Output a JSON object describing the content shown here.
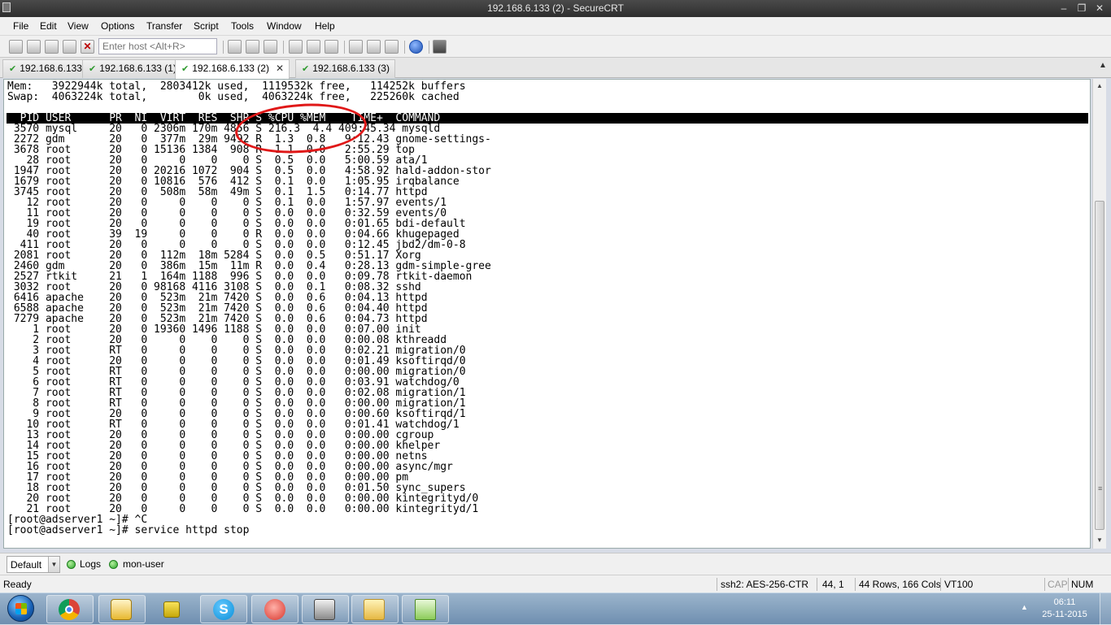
{
  "window": {
    "title": "192.168.6.133 (2) - SecureCRT"
  },
  "menu": [
    "File",
    "Edit",
    "View",
    "Options",
    "Transfer",
    "Script",
    "Tools",
    "Window",
    "Help"
  ],
  "toolbar": {
    "host_placeholder": "Enter host <Alt+R>"
  },
  "tabs": [
    {
      "label": "192.168.6.133",
      "active": false
    },
    {
      "label": "192.168.6.133 (1)",
      "active": false
    },
    {
      "label": "192.168.6.133 (2)",
      "active": true
    },
    {
      "label": "192.168.6.133 (3)",
      "active": false
    }
  ],
  "terminal": {
    "lines": [
      "Mem:   3922944k total,  2803412k used,  1119532k free,   114252k buffers",
      "Swap:  4063224k total,        0k used,  4063224k free,   225260k cached",
      "",
      "  PID USER      PR  NI  VIRT  RES  SHR S %CPU %MEM    TIME+  COMMAND",
      " 3570 mysql     20   0 2306m 170m 4856 S 216.3  4.4 409:45.34 mysqld",
      " 2272 gdm       20   0  377m  29m 9492 R  1.3  0.8   9:12.43 gnome-settings-",
      " 3678 root      20   0 15136 1384  908 R  1.1  0.0   2:55.29 top",
      "   28 root      20   0     0    0    0 S  0.5  0.0   5:00.59 ata/1",
      " 1947 root      20   0 20216 1072  904 S  0.5  0.0   4:58.92 hald-addon-stor",
      " 1679 root      20   0 10816  576  412 S  0.1  0.0   1:05.95 irqbalance",
      " 3745 root      20   0  508m  58m  49m S  0.1  1.5   0:14.77 httpd",
      "   12 root      20   0     0    0    0 S  0.1  0.0   1:57.97 events/1",
      "   11 root      20   0     0    0    0 S  0.0  0.0   0:32.59 events/0",
      "   19 root      20   0     0    0    0 S  0.0  0.0   0:01.65 bdi-default",
      "   40 root      39  19     0    0    0 R  0.0  0.0   0:04.66 khugepaged",
      "  411 root      20   0     0    0    0 S  0.0  0.0   0:12.45 jbd2/dm-0-8",
      " 2081 root      20   0  112m  18m 5284 S  0.0  0.5   0:51.17 Xorg",
      " 2460 gdm       20   0  386m  15m  11m R  0.0  0.4   0:28.13 gdm-simple-gree",
      " 2527 rtkit     21   1  164m 1188  996 S  0.0  0.0   0:09.78 rtkit-daemon",
      " 3032 root      20   0 98168 4116 3108 S  0.0  0.1   0:08.32 sshd",
      " 6416 apache    20   0  523m  21m 7420 S  0.0  0.6   0:04.13 httpd",
      " 6588 apache    20   0  523m  21m 7420 S  0.0  0.6   0:04.40 httpd",
      " 7279 apache    20   0  523m  21m 7420 S  0.0  0.6   0:04.73 httpd",
      "    1 root      20   0 19360 1496 1188 S  0.0  0.0   0:07.00 init",
      "    2 root      20   0     0    0    0 S  0.0  0.0   0:00.08 kthreadd",
      "    3 root      RT   0     0    0    0 S  0.0  0.0   0:02.21 migration/0",
      "    4 root      20   0     0    0    0 S  0.0  0.0   0:01.49 ksoftirqd/0",
      "    5 root      RT   0     0    0    0 S  0.0  0.0   0:00.00 migration/0",
      "    6 root      RT   0     0    0    0 S  0.0  0.0   0:03.91 watchdog/0",
      "    7 root      RT   0     0    0    0 S  0.0  0.0   0:02.08 migration/1",
      "    8 root      RT   0     0    0    0 S  0.0  0.0   0:00.00 migration/1",
      "    9 root      20   0     0    0    0 S  0.0  0.0   0:00.60 ksoftirqd/1",
      "   10 root      RT   0     0    0    0 S  0.0  0.0   0:01.41 watchdog/1",
      "   13 root      20   0     0    0    0 S  0.0  0.0   0:00.00 cgroup",
      "   14 root      20   0     0    0    0 S  0.0  0.0   0:00.00 khelper",
      "   15 root      20   0     0    0    0 S  0.0  0.0   0:00.00 netns",
      "   16 root      20   0     0    0    0 S  0.0  0.0   0:00.00 async/mgr",
      "   17 root      20   0     0    0    0 S  0.0  0.0   0:00.00 pm",
      "   18 root      20   0     0    0    0 S  0.0  0.0   0:01.50 sync_supers",
      "   20 root      20   0     0    0    0 S  0.0  0.0   0:00.00 kintegrityd/0",
      "   21 root      20   0     0    0    0 S  0.0  0.0   0:00.00 kintegrityd/1",
      "[root@adserver1 ~]# ^C",
      "[root@adserver1 ~]# service httpd stop"
    ]
  },
  "buttonbar": {
    "session_combo": "Default",
    "buttons": [
      "Logs",
      "mon-user"
    ]
  },
  "status": {
    "ready": "Ready",
    "cipher": "ssh2: AES-256-CTR",
    "cursor": "44,  1",
    "size": "44 Rows, 166 Cols",
    "emulation": "VT100",
    "cap": "CAP",
    "num": "NUM"
  },
  "taskbar": {
    "time": "06:11",
    "date": "25-11-2015",
    "apps": [
      "windows-start-icon",
      "chrome-icon",
      "outlook-icon",
      "lock-icon",
      "skype-icon",
      "snail-icon",
      "securecrt-icon",
      "folder-icon",
      "notepad-icon"
    ]
  }
}
